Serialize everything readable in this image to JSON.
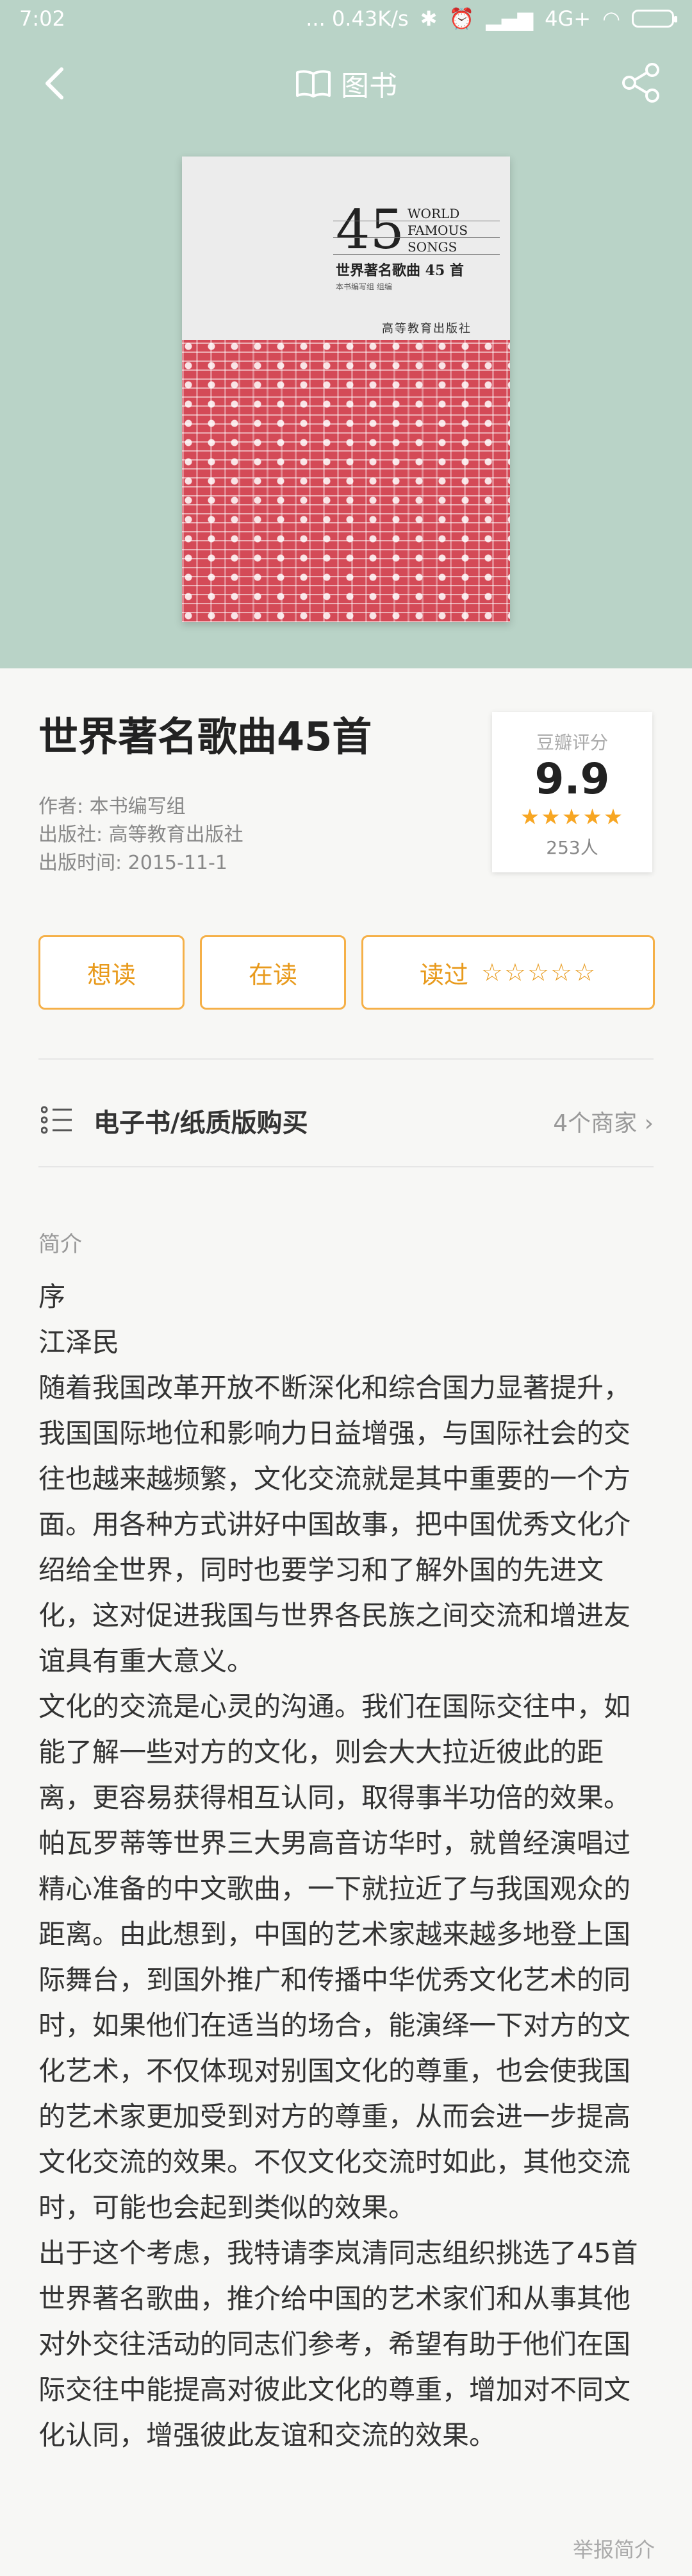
{
  "status_bar": {
    "time": "7:02",
    "network": "... 0.43K/s",
    "signal": "4G+"
  },
  "nav": {
    "title": "图书"
  },
  "cover": {
    "number": "45",
    "english_lines": [
      "WORLD",
      "FAMOUS",
      "SONGS"
    ],
    "chinese_title": "世界著名歌曲 45 首",
    "editor": "本书编写组 组编",
    "publisher_mark": "高等教育出版社"
  },
  "book": {
    "title": "世界著名歌曲45首",
    "author": "作者: 本书编写组",
    "publisher": "出版社: 高等教育出版社",
    "pub_date": "出版时间: 2015-11-1"
  },
  "rating": {
    "label": "豆瓣评分",
    "score": "9.9",
    "stars": "★★★★★",
    "count": "253人"
  },
  "actions": {
    "want": "想读",
    "reading": "在读",
    "read": "读过",
    "read_stars": "☆☆☆☆☆"
  },
  "buy": {
    "label": "电子书/纸质版购买",
    "merchants": "4个商家"
  },
  "intro": {
    "heading": "简介",
    "lines": [
      "序",
      "江泽民",
      "随着我国改革开放不断深化和综合国力显著提升，我国国际地位和影响力日益增强，与国际社会的交往也越来越频繁，文化交流就是其中重要的一个方面。用各种方式讲好中国故事，把中国优秀文化介绍给全世界，同时也要学习和了解外国的先进文化，这对促进我国与世界各民族之间交流和增进友谊具有重大意义。",
      "文化的交流是心灵的沟通。我们在国际交往中，如能了解一些对方的文化，则会大大拉近彼此的距离，更容易获得相互认同，取得事半功倍的效果。帕瓦罗蒂等世界三大男高音访华时，就曾经演唱过精心准备的中文歌曲，一下就拉近了与我国观众的距离。由此想到，中国的艺术家越来越多地登上国际舞台，到国外推广和传播中华优秀文化艺术的同时，如果他们在适当的场合，能演绎一下对方的文化艺术，不仅体现对别国文化的尊重，也会使我国的艺术家更加受到对方的尊重，从而会进一步提高文化交流的效果。不仅文化交流时如此，其他交流时，可能也会起到类似的效果。",
      "出于这个考虑，我特请李岚清同志组织挑选了45首世界著名歌曲，推介给中国的艺术家们和从事其他对外交往活动的同志们参考，希望有助于他们在国际交往中能提高对彼此文化的尊重，增加对不同文化认同，增强彼此友谊和交流的效果。"
    ],
    "report": "举报简介"
  }
}
